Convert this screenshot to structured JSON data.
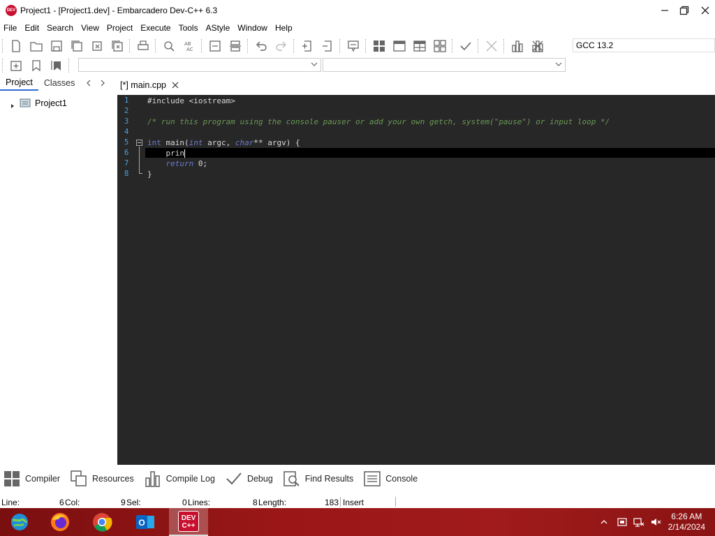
{
  "window": {
    "title": "Project1 - [Project1.dev] - Embarcadero Dev-C++ 6.3",
    "app_icon_text": "DEV"
  },
  "menu": [
    "File",
    "Edit",
    "Search",
    "View",
    "Project",
    "Execute",
    "Tools",
    "AStyle",
    "Window",
    "Help"
  ],
  "toolbar": {
    "compiler": "GCC 13.2"
  },
  "left_panel": {
    "tabs": [
      "Project",
      "Classes"
    ],
    "tree_root": "Project1"
  },
  "editor": {
    "tab_label": "[*] main.cpp",
    "lines": [
      "1",
      "2",
      "3",
      "4",
      "5",
      "6",
      "7",
      "8"
    ],
    "code": {
      "l1": "#include <iostream>",
      "l3": "/* run this program using the console pauser or add your own getch, system(\"pause\") or input loop */",
      "l5_kw1": "int",
      "l5_a": " main(",
      "l5_kw2": "int",
      "l5_b": " argc, ",
      "l5_kw3": "char",
      "l5_c": "** argv) {",
      "l6": "    prin",
      "l7_kw": "return",
      "l7_rest": " 0;",
      "l8": "}"
    }
  },
  "bottom_tabs": [
    "Compiler",
    "Resources",
    "Compile Log",
    "Debug",
    "Find Results",
    "Console"
  ],
  "status": {
    "line_label": "Line:",
    "line_val": "6",
    "col_label": "Col:",
    "col_val": "9",
    "sel_label": "Sel:",
    "sel_val": "0",
    "lines_label": "Lines:",
    "lines_val": "8",
    "length_label": "Length:",
    "length_val": "183",
    "mode": "Insert"
  },
  "taskbar": {
    "time": "6:26 AM",
    "date": "2/14/2024",
    "devcpp_label_1": "DEV",
    "devcpp_label_2": "C++"
  }
}
